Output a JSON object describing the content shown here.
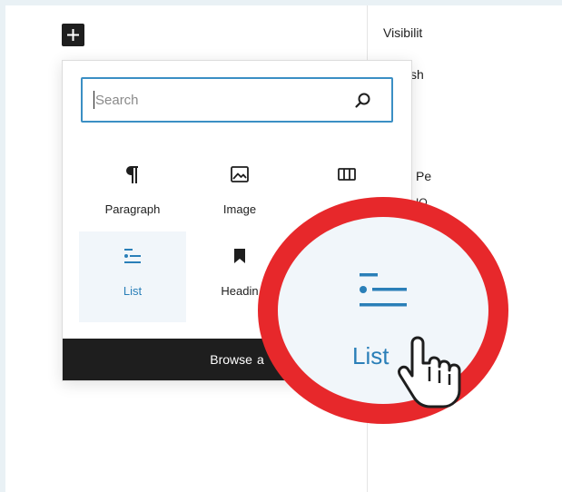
{
  "header": {
    "inserter_toggle_icon": "plus-icon"
  },
  "sidebar": {
    "visibility_label": "Visibilit",
    "publish_fragment": "sh",
    "post_format_fragment": "Pe",
    "template_fragment": "IO"
  },
  "inserter": {
    "search": {
      "placeholder": "Search",
      "value": "",
      "icon": "search-icon"
    },
    "blocks": [
      {
        "label": "Paragraph",
        "icon": "paragraph-icon",
        "selected": false
      },
      {
        "label": "Image",
        "icon": "image-icon",
        "selected": false
      },
      {
        "label": "C",
        "icon": "columns-icon",
        "selected": false
      },
      {
        "label": "List",
        "icon": "list-icon",
        "selected": true
      },
      {
        "label": "Headin",
        "icon": "heading-bookmark-icon",
        "selected": false
      }
    ],
    "browse_label": "Browse",
    "browse_suffix": "a"
  },
  "zoom": {
    "label": "List",
    "icon": "list-icon",
    "cursor": "hand-pointer-icon"
  },
  "colors": {
    "accent": "#2a7fb8",
    "ring": "#e7282b",
    "selected_bg": "#f1f6fa",
    "dark": "#1e1e1e"
  }
}
